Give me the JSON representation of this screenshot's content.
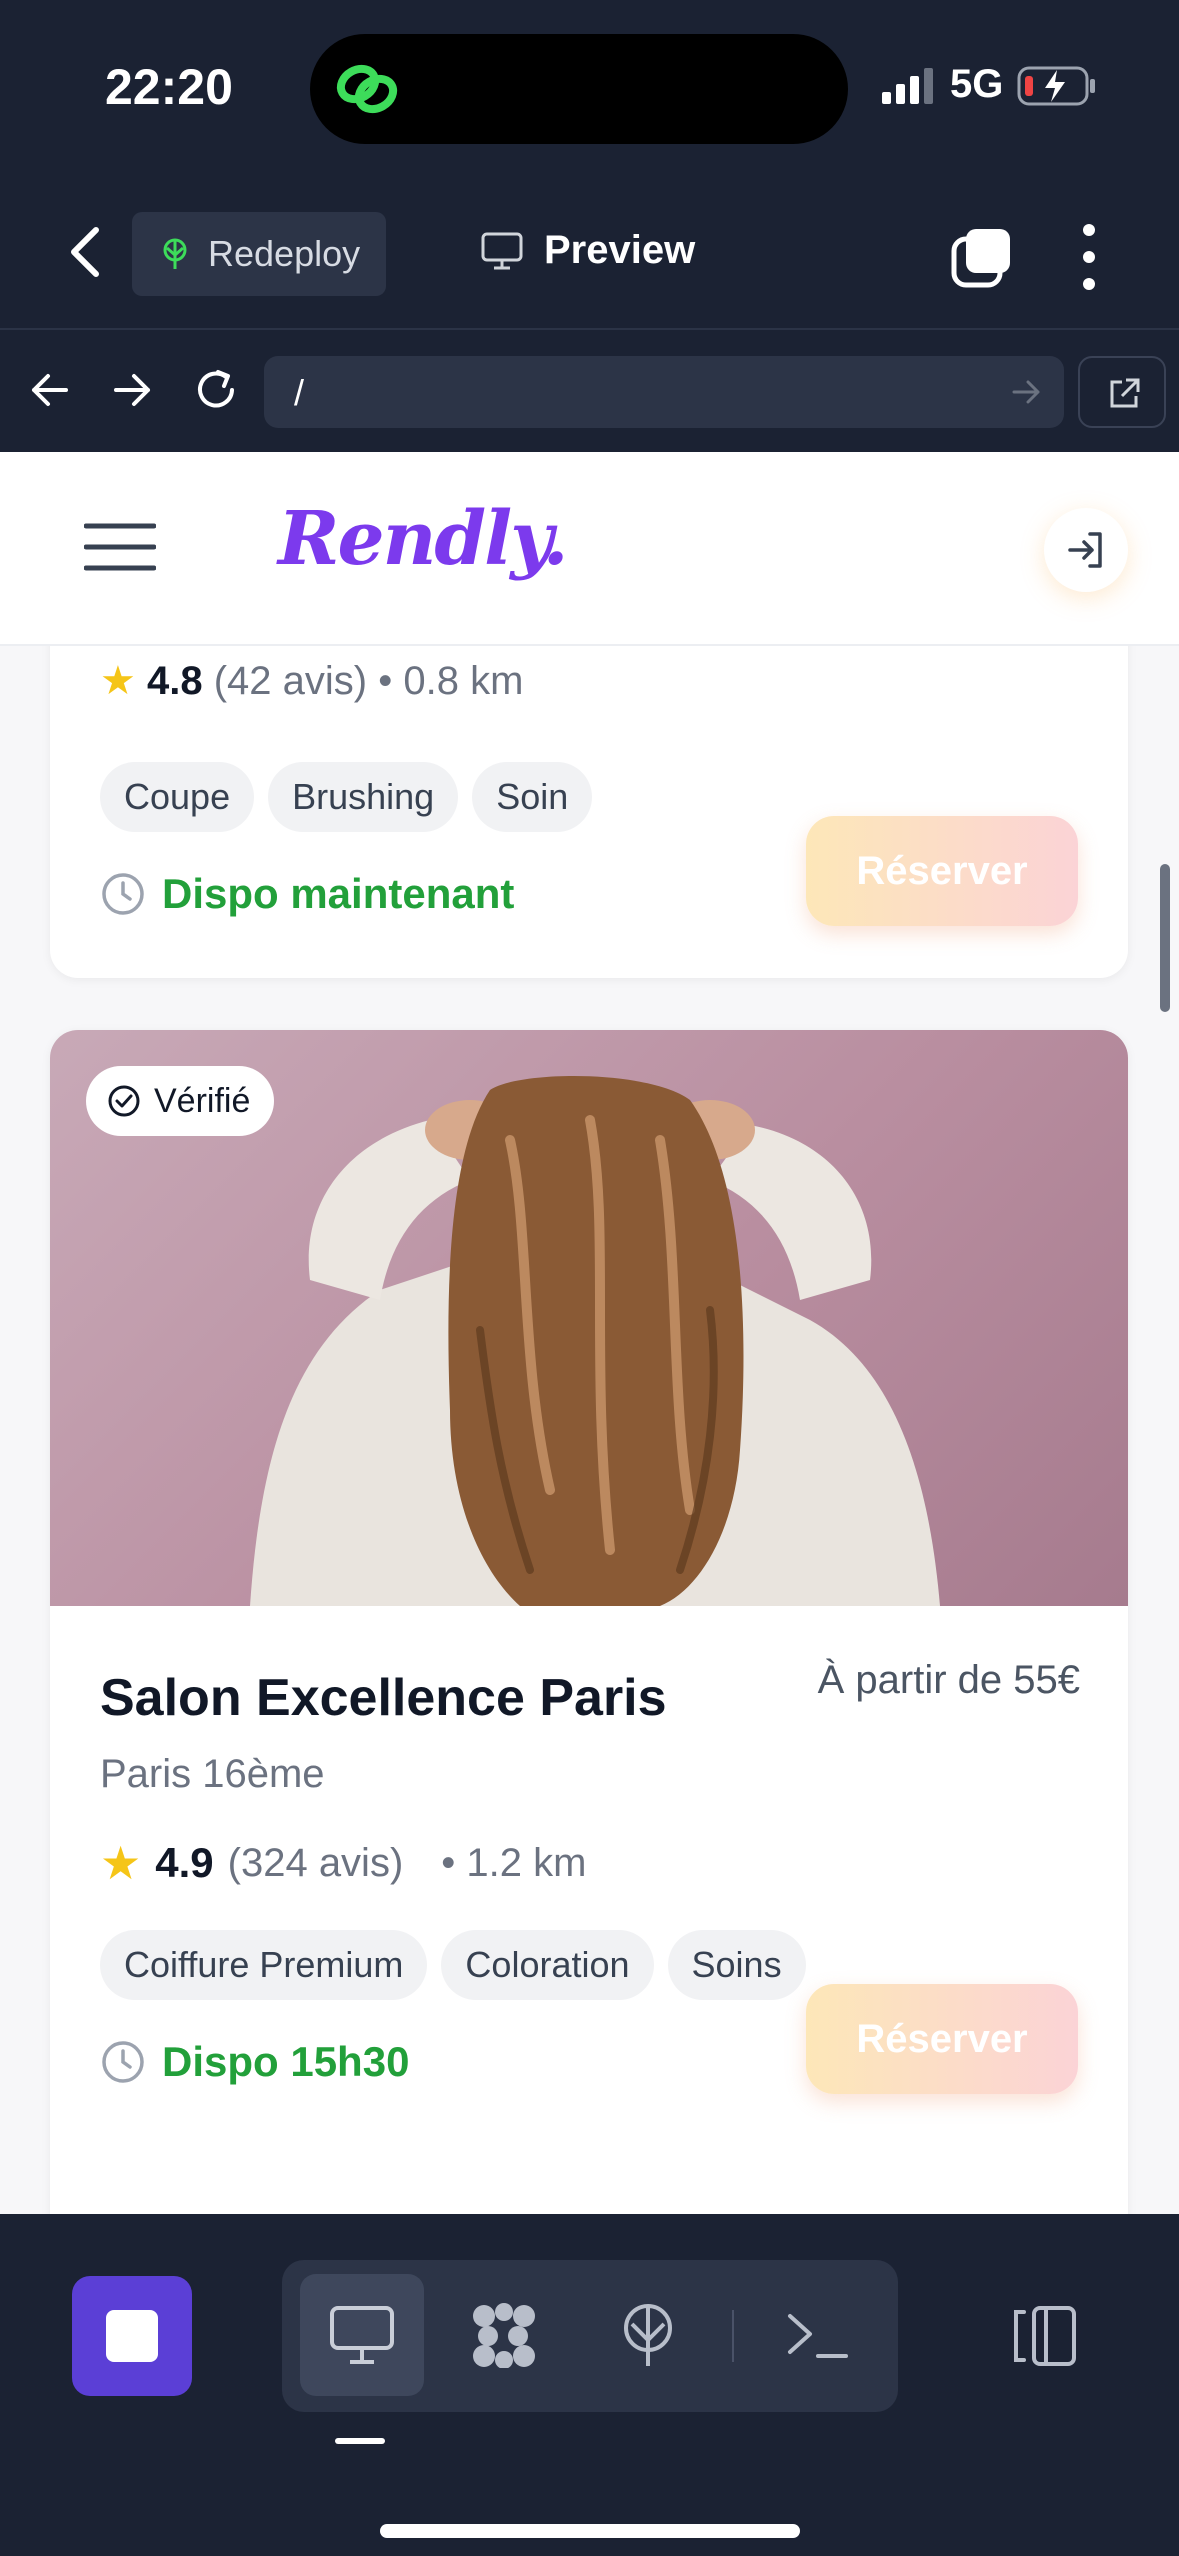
{
  "status": {
    "time": "22:20",
    "network": "5G"
  },
  "appbar": {
    "redeploy_label": "Redeploy",
    "preview_label": "Preview"
  },
  "address": {
    "url": "/"
  },
  "site": {
    "brand": "Rendly.",
    "accent": "#7c3aed",
    "card1": {
      "rating": "4.8",
      "reviews": "(42 avis)",
      "distance": "• 0.8 km",
      "chips": [
        "Coupe",
        "Brushing",
        "Soin"
      ],
      "availability": "Dispo maintenant",
      "reserve_label": "Réserver"
    },
    "card2": {
      "badge": "Vérifié",
      "name": "Salon Excellence Paris",
      "price": "À partir de 55€",
      "city": "Paris 16ème",
      "rating": "4.9",
      "reviews": "(324 avis)",
      "distance": "• 1.2 km",
      "chips": [
        "Coiffure Premium",
        "Coloration",
        "Soins"
      ],
      "availability": "Dispo 15h30",
      "reserve_label": "Réserver"
    }
  },
  "colors": {
    "available_green": "#22a03a",
    "stop_button": "#5b3fd6",
    "chrome_bg": "#1b2233"
  }
}
